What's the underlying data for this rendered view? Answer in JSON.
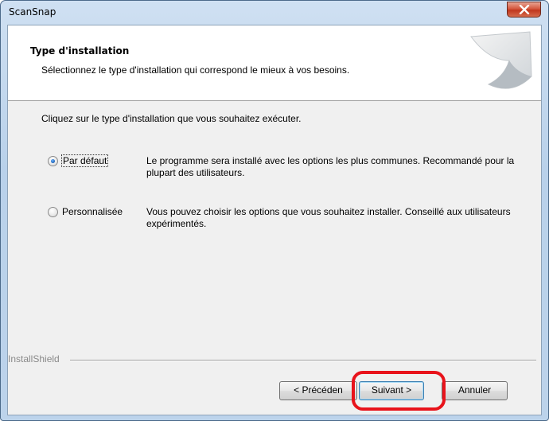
{
  "window": {
    "title": "ScanSnap"
  },
  "header": {
    "title": "Type d'installation",
    "subtitle": "Sélectionnez le type d'installation qui correspond le mieux à vos besoins."
  },
  "content": {
    "instruction": "Cliquez sur le type d'installation que vous souhaitez exécuter.",
    "options": [
      {
        "label": "Par défaut",
        "selected": true,
        "description": "Le programme sera installé avec les options les plus communes. Recommandé pour la plupart des utilisateurs."
      },
      {
        "label": "Personnalisée",
        "selected": false,
        "description": "Vous pouvez choisir les options que vous souhaitez installer. Conseillé aux utilisateurs expérimentés."
      }
    ]
  },
  "footer": {
    "brand": "InstallShield",
    "prev_label": "< Précéden",
    "next_label": "Suivant >",
    "cancel_label": "Annuler"
  },
  "colors": {
    "highlight": "#e8131b",
    "close_button": "#c0361d"
  }
}
